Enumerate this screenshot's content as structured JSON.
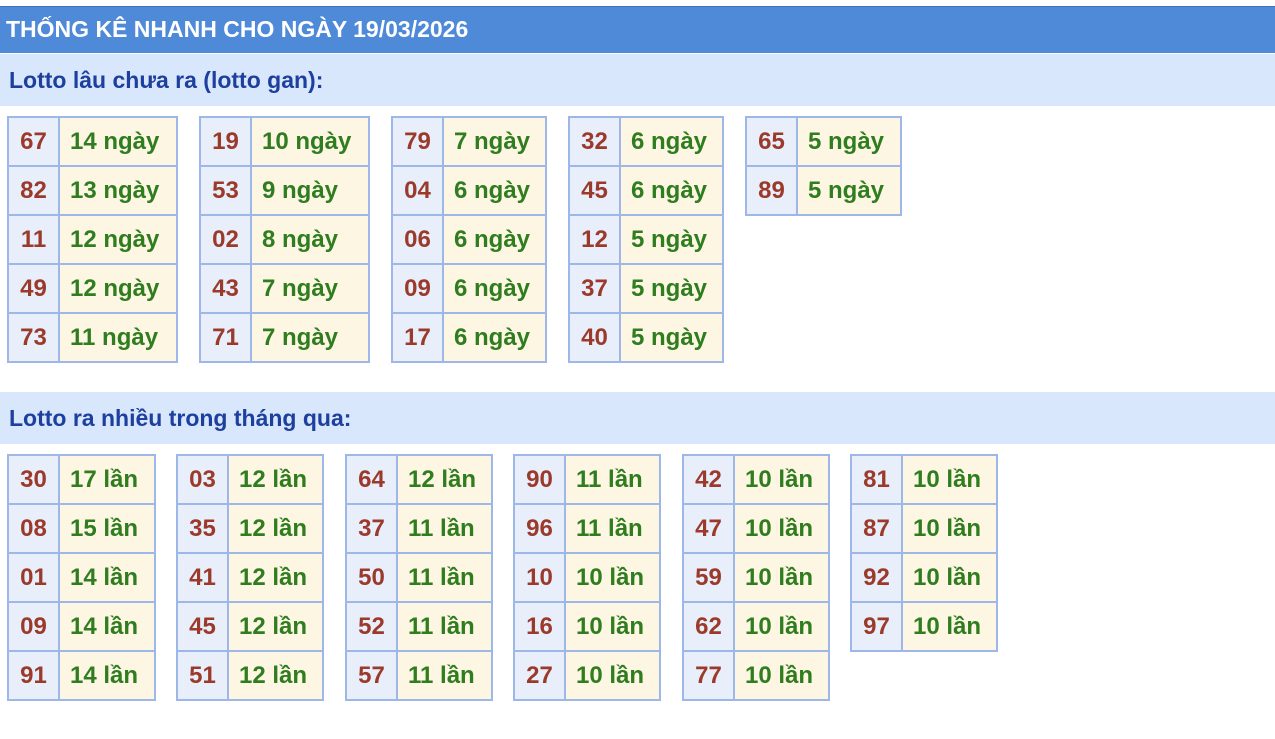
{
  "title": "THỐNG KÊ NHANH CHO NGÀY 19/03/2026",
  "gan": {
    "heading": "Lotto lâu chưa ra (lotto gan):",
    "groups": [
      [
        {
          "num": "67",
          "val": "14 ngày"
        },
        {
          "num": "82",
          "val": "13 ngày"
        },
        {
          "num": "11",
          "val": "12 ngày"
        },
        {
          "num": "49",
          "val": "12 ngày"
        },
        {
          "num": "73",
          "val": "11 ngày"
        }
      ],
      [
        {
          "num": "19",
          "val": "10 ngày"
        },
        {
          "num": "53",
          "val": "9 ngày"
        },
        {
          "num": "02",
          "val": "8 ngày"
        },
        {
          "num": "43",
          "val": "7 ngày"
        },
        {
          "num": "71",
          "val": "7 ngày"
        }
      ],
      [
        {
          "num": "79",
          "val": "7 ngày"
        },
        {
          "num": "04",
          "val": "6 ngày"
        },
        {
          "num": "06",
          "val": "6 ngày"
        },
        {
          "num": "09",
          "val": "6 ngày"
        },
        {
          "num": "17",
          "val": "6 ngày"
        }
      ],
      [
        {
          "num": "32",
          "val": "6 ngày"
        },
        {
          "num": "45",
          "val": "6 ngày"
        },
        {
          "num": "12",
          "val": "5 ngày"
        },
        {
          "num": "37",
          "val": "5 ngày"
        },
        {
          "num": "40",
          "val": "5 ngày"
        }
      ],
      [
        {
          "num": "65",
          "val": "5 ngày"
        },
        {
          "num": "89",
          "val": "5 ngày"
        }
      ]
    ]
  },
  "nhieu": {
    "heading": "Lotto ra nhiều trong tháng qua:",
    "groups": [
      [
        {
          "num": "30",
          "val": "17 lần"
        },
        {
          "num": "08",
          "val": "15 lần"
        },
        {
          "num": "01",
          "val": "14 lần"
        },
        {
          "num": "09",
          "val": "14 lần"
        },
        {
          "num": "91",
          "val": "14 lần"
        }
      ],
      [
        {
          "num": "03",
          "val": "12 lần"
        },
        {
          "num": "35",
          "val": "12 lần"
        },
        {
          "num": "41",
          "val": "12 lần"
        },
        {
          "num": "45",
          "val": "12 lần"
        },
        {
          "num": "51",
          "val": "12 lần"
        }
      ],
      [
        {
          "num": "64",
          "val": "12 lần"
        },
        {
          "num": "37",
          "val": "11 lần"
        },
        {
          "num": "50",
          "val": "11 lần"
        },
        {
          "num": "52",
          "val": "11 lần"
        },
        {
          "num": "57",
          "val": "11 lần"
        }
      ],
      [
        {
          "num": "90",
          "val": "11 lần"
        },
        {
          "num": "96",
          "val": "11 lần"
        },
        {
          "num": "10",
          "val": "10 lần"
        },
        {
          "num": "16",
          "val": "10 lần"
        },
        {
          "num": "27",
          "val": "10 lần"
        }
      ],
      [
        {
          "num": "42",
          "val": "10 lần"
        },
        {
          "num": "47",
          "val": "10 lần"
        },
        {
          "num": "59",
          "val": "10 lần"
        },
        {
          "num": "62",
          "val": "10 lần"
        },
        {
          "num": "77",
          "val": "10 lần"
        }
      ],
      [
        {
          "num": "81",
          "val": "10 lần"
        },
        {
          "num": "87",
          "val": "10 lần"
        },
        {
          "num": "92",
          "val": "10 lần"
        },
        {
          "num": "97",
          "val": "10 lần"
        }
      ]
    ]
  }
}
